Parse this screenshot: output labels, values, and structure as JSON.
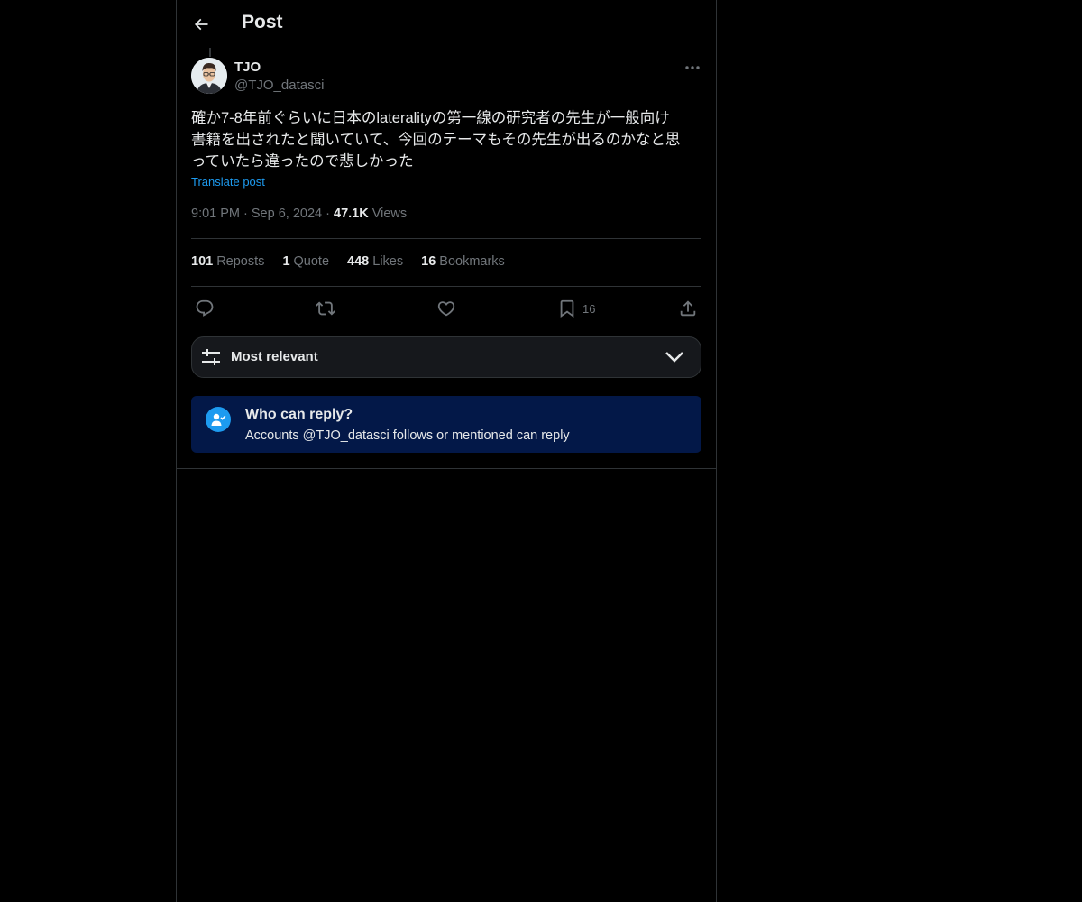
{
  "header": {
    "title": "Post"
  },
  "post": {
    "author_name": "TJO",
    "author_handle": "@TJO_datasci",
    "text_line1": "確か7-8年前ぐらいに日本のlateralityの第一線の研究者の先生が一般向け",
    "text_line2": "書籍を出されたと聞いていて、今回のテーマもその先生が出るのかなと思",
    "text_line3": "っていたら違ったので悲しかった",
    "translate_label": "Translate post",
    "time": "9:01 PM",
    "date": "Sep 6, 2024",
    "views_count": "47.1K",
    "views_label": "Views"
  },
  "stats": {
    "reposts_count": "101",
    "reposts_label": "Reposts",
    "quotes_count": "1",
    "quotes_label": "Quote",
    "likes_count": "448",
    "likes_label": "Likes",
    "bookmarks_count": "16",
    "bookmarks_label": "Bookmarks"
  },
  "actions": {
    "bookmark_count": "16"
  },
  "sort": {
    "label": "Most relevant"
  },
  "reply_restriction": {
    "title": "Who can reply?",
    "subtitle": "Accounts @TJO_datasci follows or mentioned can reply"
  },
  "colors": {
    "accent": "#1d9bf0",
    "background": "#000000",
    "text": "#e7e9ea",
    "muted": "#71767b",
    "reply_box_bg": "#031848"
  }
}
